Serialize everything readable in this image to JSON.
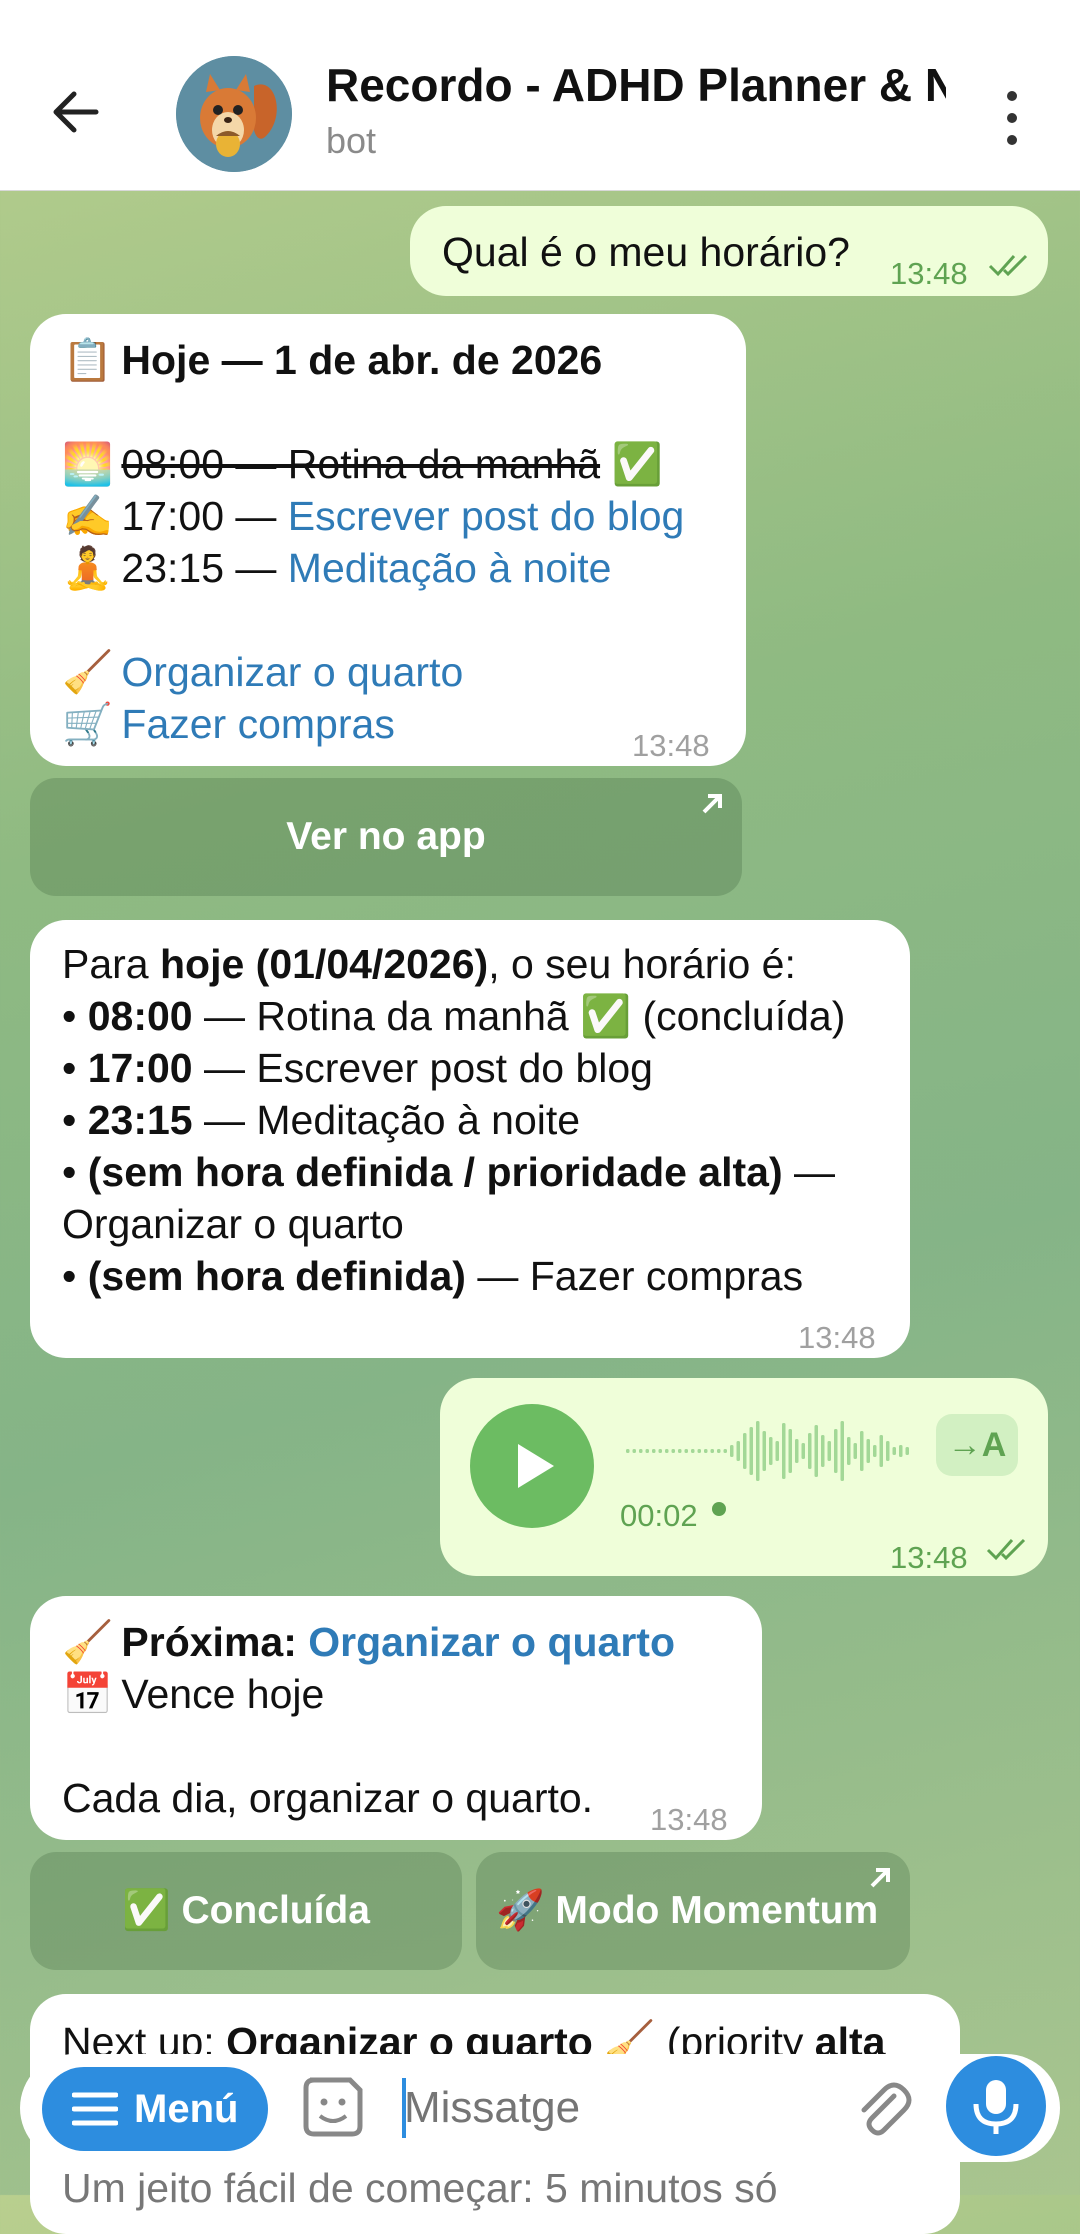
{
  "header": {
    "title": "Recordo - ADHD Planner & N",
    "subtitle": "bot"
  },
  "messages": {
    "m1": {
      "text": "Qual é o meu horário?",
      "time": "13:48"
    },
    "m2": {
      "title": "Hoje — 1 de abr. de 2026",
      "r1_time": "08:00 — Rotina da manhã",
      "r2_time": "17:00 — ",
      "r2_task": "Escrever post do blog",
      "r3_time": "23:15 — ",
      "r3_task": "Meditação à noite",
      "r4_task": "Organizar o quarto",
      "r5_task": "Fazer compras",
      "time": "13:48",
      "button": "Ver no app"
    },
    "m3": {
      "p1a": "Para ",
      "p1b": "hoje (01/04/2026)",
      "p1c": ", o seu horário é:",
      "l1b": "08:00",
      "l1c": " — Rotina da manhã ",
      "l1d": " (concluída)",
      "l2b": "17:00",
      "l2c": " — Escrever post do blog",
      "l3b": "23:15",
      "l3c": " — Meditação à noite",
      "l4b": "(sem hora definida / prioridade alta)",
      "l4c": " —",
      "l4d": "Organizar o quarto",
      "l5b": "(sem hora definida)",
      "l5c": " — Fazer compras",
      "time": "13:48"
    },
    "m4": {
      "duration": "00:02",
      "time": "13:48",
      "transcribe": "→A"
    },
    "m5": {
      "label": "Próxima: ",
      "task": "Organizar o quarto",
      "due": "Vence hoje",
      "desc": "Cada dia, organizar o quarto.",
      "time": "13:48",
      "btn1": "Concluída",
      "btn2": "Modo Momentum"
    },
    "m6": {
      "text_a": "Next up: ",
      "text_b": "Organizar o quarto",
      "text_c": " (priority ",
      "text_d": "alta",
      "text_e": "Um jeito fácil de começar: 5 minutos só"
    }
  },
  "composer": {
    "menu_label": "Menú",
    "placeholder": "Missatge"
  },
  "colors": {
    "accent": "#2d8ddf",
    "link": "#2f7bb7",
    "outgoing_bubble": "#effed9",
    "check_green": "#5fa352"
  }
}
